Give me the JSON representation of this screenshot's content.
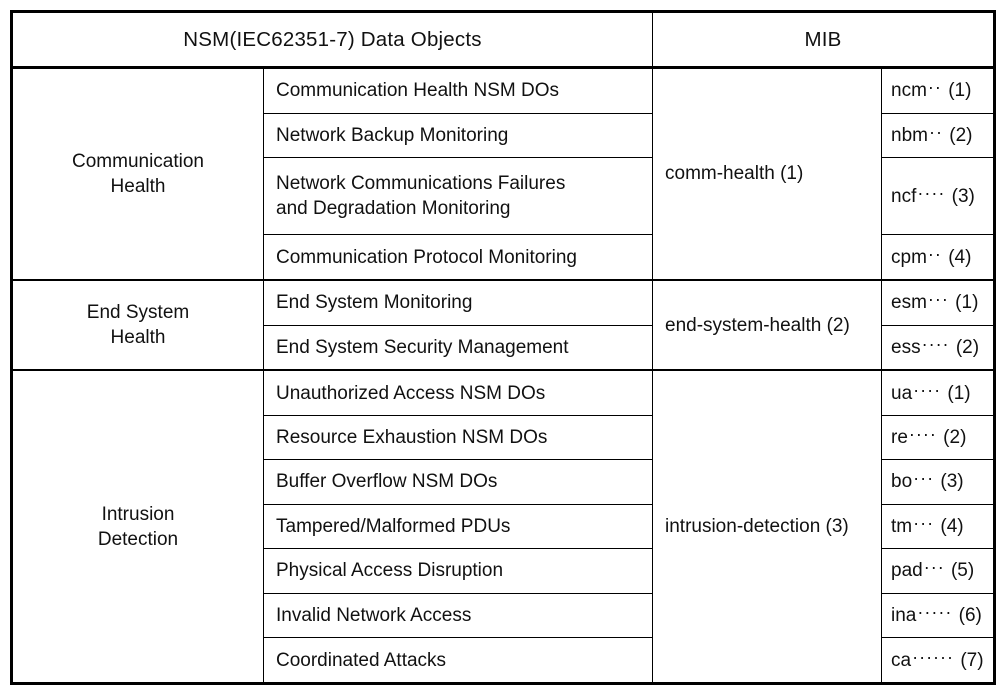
{
  "table": {
    "headers": {
      "data_objects": "NSM(IEC62351-7) Data Objects",
      "mib": "MIB"
    },
    "groups": [
      {
        "name": "Communication\nHealth",
        "name_line1": "Communication",
        "name_line2": "Health",
        "mib_label": "comm-health (1)",
        "rows": [
          {
            "object": "Communication Health NSM DOs",
            "code_abbr": "ncm",
            "leader": "··",
            "code_num": "(1)"
          },
          {
            "object": "Network Backup Monitoring",
            "code_abbr": "nbm",
            "leader": "··",
            "code_num": "(2)"
          },
          {
            "object": "Network Communications Failures and Degradation Monitoring",
            "object_line1": "Network Communications Failures",
            "object_line2": "and Degradation Monitoring",
            "code_abbr": "ncf",
            "leader": "····",
            "code_num": "(3)"
          },
          {
            "object": "Communication Protocol Monitoring",
            "code_abbr": "cpm",
            "leader": "··",
            "code_num": "(4)"
          }
        ]
      },
      {
        "name": "End System\nHealth",
        "name_line1": "End System",
        "name_line2": "Health",
        "mib_label": "end-system-health (2)",
        "rows": [
          {
            "object": "End System Monitoring",
            "code_abbr": "esm",
            "leader": "···",
            "code_num": "(1)"
          },
          {
            "object": "End System Security Management",
            "code_abbr": "ess",
            "leader": "····",
            "code_num": "(2)"
          }
        ]
      },
      {
        "name": "Intrusion\nDetection",
        "name_line1": "Intrusion",
        "name_line2": "Detection",
        "mib_label": "intrusion-detection (3)",
        "rows": [
          {
            "object": "Unauthorized Access NSM DOs",
            "code_abbr": "ua",
            "leader": "····",
            "code_num": "(1)"
          },
          {
            "object": "Resource Exhaustion NSM DOs",
            "code_abbr": "re",
            "leader": "····",
            "code_num": "(2)"
          },
          {
            "object": "Buffer Overflow NSM DOs",
            "code_abbr": "bo",
            "leader": "···",
            "code_num": "(3)"
          },
          {
            "object": "Tampered/Malformed PDUs",
            "code_abbr": "tm",
            "leader": "···",
            "code_num": "(4)"
          },
          {
            "object": "Physical Access Disruption",
            "code_abbr": "pad",
            "leader": "···",
            "code_num": "(5)"
          },
          {
            "object": "Invalid Network Access",
            "code_abbr": "ina",
            "leader": "·····",
            "code_num": "(6)"
          },
          {
            "object": "Coordinated Attacks",
            "code_abbr": "ca",
            "leader": "······",
            "code_num": "(7)"
          }
        ]
      }
    ]
  }
}
